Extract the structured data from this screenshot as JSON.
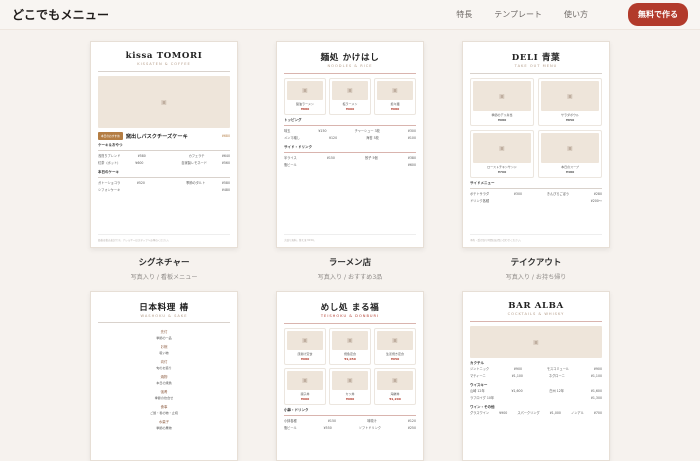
{
  "header": {
    "brand": "どこでもメニュー",
    "nav": [
      "特長",
      "テンプレート",
      "使い方"
    ],
    "cta": "無料で作る"
  },
  "cards": [
    {
      "title": "kissa TOMORI",
      "subtitle": "KISSATEN & COFFEE",
      "signature_tag": "本日のおすすめ",
      "signature_name": "窯出しバスクチーズケーキ",
      "signature_price": "¥680",
      "section1": "ケーキ＆おやつ",
      "items1": [
        [
          "浅煎りブレンド",
          "¥580"
        ],
        [
          "カフェラテ",
          "¥640"
        ],
        [
          "紅茶（ポット）",
          "¥600"
        ],
        [
          "自家製レモネード",
          "¥560"
        ]
      ],
      "section2": "本日のケーキ",
      "items2": [
        [
          "ガトーショコラ",
          "¥520"
        ],
        [
          "季節のタルト",
          "¥580"
        ],
        [
          "シフォンケーキ",
          "¥480"
        ]
      ],
      "footer": "価格は税込表記です。アレルギーはスタッフへお尋ねください。",
      "caption": "シグネチャー",
      "meta": "写真入り / 看板メニュー"
    },
    {
      "title": "麺処 かけはし",
      "subtitle": "NOODLES & RICE",
      "tiles": [
        [
          "醤油ラーメン",
          "¥880"
        ],
        [
          "塩ラーメン",
          "¥900"
        ],
        [
          "担々麺",
          "¥980"
        ]
      ],
      "section1": "トッピング",
      "items1": [
        [
          "味玉",
          "¥150"
        ],
        [
          "チャーシュー 3枚",
          "¥300"
        ],
        [
          "メンマ増し",
          "¥120"
        ],
        [
          "海苔 5枚",
          "¥100"
        ]
      ],
      "section2": "サイド・ドリンク",
      "items2": [
        [
          "半ライス",
          "¥150"
        ],
        [
          "餃子 5個",
          "¥380"
        ],
        [
          "瓶ビール",
          "¥600"
        ]
      ],
      "footer": "大盛り無料。替え玉 ¥150。",
      "caption": "ラーメン店",
      "meta": "写真入り / おすすめ3品"
    },
    {
      "title": "DELI 青葉",
      "subtitle": "TAKE OUT MENU",
      "tiles": [
        [
          "季節のデリ弁当",
          "¥980"
        ],
        [
          "サラダボウル",
          "¥850"
        ],
        [
          "ローストチキンサンド",
          "¥760"
        ],
        [
          "本日のスープ",
          "¥480"
        ]
      ],
      "section1": "サイドメニュー",
      "items1": [
        [
          "ポテトサラダ",
          "¥300"
        ],
        [
          "きんぴらごぼう",
          "¥280"
        ],
        [
          "ドリンク各種",
          "¥200〜"
        ]
      ],
      "footer": "予約・受け取り時間はお問い合わせください。",
      "caption": "テイクアウト",
      "meta": "写真入り / お持ち帰り"
    },
    {
      "title": "日本料理 椿",
      "subtitle": "WASHOKU & SAKE",
      "courses": [
        [
          "先付",
          "季節の一品"
        ],
        [
          "お椀",
          "吸い物"
        ],
        [
          "向付",
          "旬のお造り"
        ],
        [
          "焼物",
          "本日の焼魚"
        ],
        [
          "強肴",
          "季節の炊合せ"
        ],
        [
          "食事",
          "ご飯・香の物・止椀"
        ],
        [
          "水菓子",
          "季節の果物"
        ]
      ],
      "caption": "",
      "meta": ""
    },
    {
      "title": "めし処 まる福",
      "subtitle": "TEISHOKU & DONBURI",
      "tiles": [
        [
          "唐揚げ定食",
          "¥980"
        ],
        [
          "焼魚定食",
          "¥1,050"
        ],
        [
          "生姜焼き定食",
          "¥950"
        ],
        [
          "親子丼",
          "¥900"
        ],
        [
          "カツ丼",
          "¥980"
        ],
        [
          "海鮮丼",
          "¥1,200"
        ]
      ],
      "section1": "小鉢・ドリンク",
      "items1": [
        [
          "小鉢各種",
          "¥150"
        ],
        [
          "味噌汁",
          "¥120"
        ],
        [
          "瓶ビール",
          "¥550"
        ],
        [
          "ソフトドリンク",
          "¥250"
        ]
      ],
      "caption": "",
      "meta": ""
    },
    {
      "title": "BAR ALBA",
      "subtitle": "COCKTAILS & WHISKY",
      "section1": "カクテル",
      "items1": [
        [
          "ジントニック",
          "¥900"
        ],
        [
          "モスコミュール",
          "¥900"
        ],
        [
          "マティーニ",
          "¥1,100"
        ],
        [
          "ネグローニ",
          "¥1,100"
        ]
      ],
      "section2": "ウイスキー",
      "items2": [
        [
          "山崎 12年",
          "¥1,600"
        ],
        [
          "白州 12年",
          "¥1,600"
        ],
        [
          "ラフロイグ 10年",
          "¥1,300"
        ]
      ],
      "section3": "ワイン・その他",
      "items3": [
        [
          "グラスワイン",
          "¥900"
        ],
        [
          "スパークリング",
          "¥1,000"
        ],
        [
          "ノンアル",
          "¥700"
        ]
      ],
      "caption": "",
      "meta": ""
    }
  ]
}
